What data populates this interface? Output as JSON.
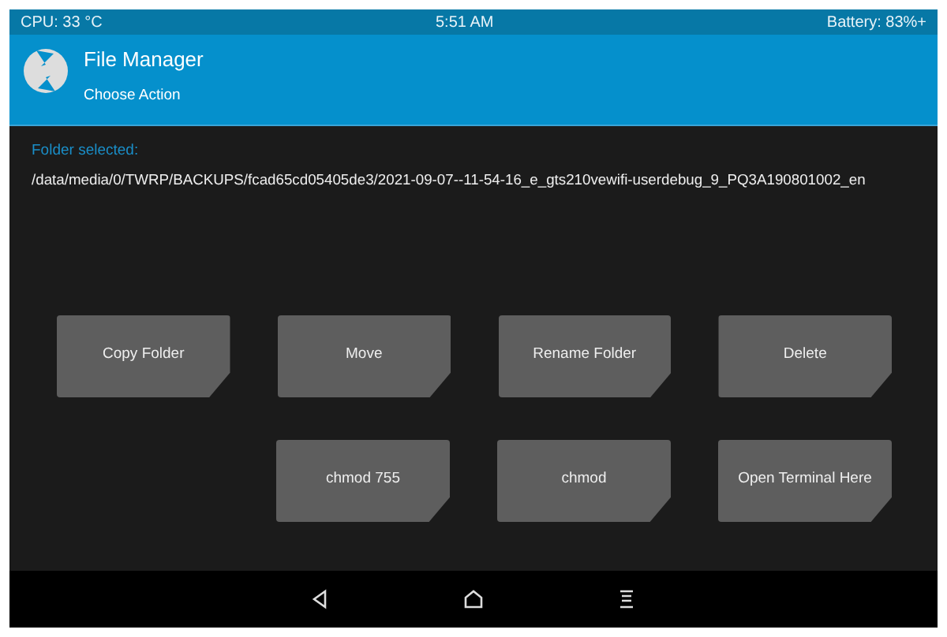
{
  "status_bar": {
    "cpu": "CPU: 33 °C",
    "time": "5:51 AM",
    "battery": "Battery: 83%+"
  },
  "header": {
    "title": "File Manager",
    "subtitle": "Choose Action"
  },
  "folder": {
    "label": "Folder selected:",
    "path": "/data/media/0/TWRP/BACKUPS/fcad65cd05405de3/2021-09-07--11-54-16_e_gts210vewifi-userdebug_9_PQ3A190801002_en"
  },
  "button_rows": [
    [
      "Copy Folder",
      "Move",
      "Rename Folder",
      "Delete"
    ],
    [
      "chmod 755",
      "chmod",
      "Open Terminal Here"
    ]
  ]
}
